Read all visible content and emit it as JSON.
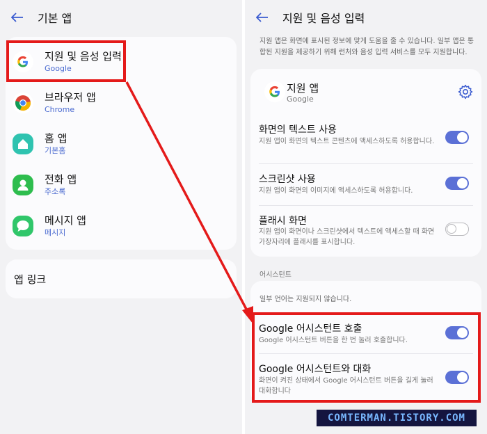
{
  "left": {
    "title": "기본 앱",
    "items": [
      {
        "title": "지원 및 음성 입력",
        "sub": "Google",
        "icon": "google-icon"
      },
      {
        "title": "브라우저 앱",
        "sub": "Chrome",
        "icon": "chrome-icon"
      },
      {
        "title": "홈 앱",
        "sub": "기본홈",
        "icon": "home-app-icon"
      },
      {
        "title": "전화 앱",
        "sub": "주소록",
        "icon": "contacts-icon"
      },
      {
        "title": "메시지 앱",
        "sub": "메시지",
        "icon": "messages-icon"
      }
    ],
    "app_link": "앱 링크"
  },
  "right": {
    "title": "지원 및 음성 입력",
    "description": "지원 앱은 화면에 표시된 정보에 맞게 도움을 줄 수 있습니다. 일부 앱은 통합된 지원을 제공하기 위해 런처와 음성 입력 서비스를 모두 지원합니다.",
    "assist_app": {
      "title": "지원 앱",
      "sub": "Google"
    },
    "settings": [
      {
        "title": "화면의 텍스트 사용",
        "sub": "지원 앱이 화면의 텍스트 콘텐츠에 액세스하도록 허용합니다.",
        "on": true
      },
      {
        "title": "스크린샷 사용",
        "sub": "지원 앱이 화면의 이미지에 액세스하도록 허용합니다.",
        "on": true
      },
      {
        "title": "플래시 화면",
        "sub": "지원 앱이 화면이나 스크린샷에서 텍스트에 액세스할 때 화면 가장자리에 플래시를 표시합니다.",
        "on": false
      }
    ],
    "assistant_section": "어시스턴트",
    "assistant_note": "일부 언어는 지원되지 않습니다.",
    "assistant_settings": [
      {
        "title": "Google 어시스턴트 호출",
        "sub": "Google 어시스턴트 버튼을 한 번 눌러 호출합니다.",
        "on": true
      },
      {
        "title": "Google 어시스턴트와 대화",
        "sub": "화면이 켜진 상태에서 Google 어시스턴트 버튼을 길게 눌러 대화합니다",
        "on": true
      }
    ]
  },
  "watermark": "COMTERMAN.TISTORY.COM",
  "colors": {
    "accent": "#5b70d6",
    "highlight": "#e41a1a",
    "sub_text": "#4a6ad0"
  }
}
